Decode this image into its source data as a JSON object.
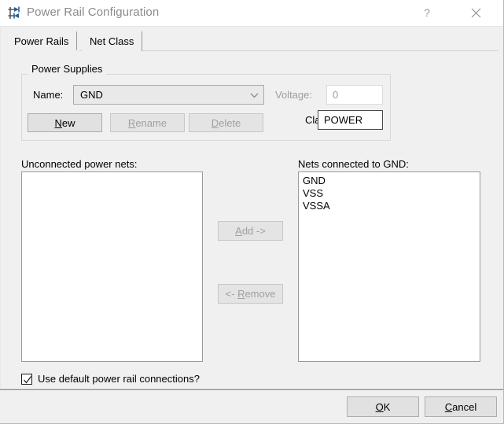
{
  "window": {
    "title": "Power Rail Configuration",
    "icon": "power-rail-icon",
    "help_label": "?",
    "close_label": "✕"
  },
  "tabs": [
    {
      "label": "Power Rails",
      "selected": true
    },
    {
      "label": "Net Class",
      "selected": false
    }
  ],
  "power_supplies": {
    "group_title": "Power Supplies",
    "name_label": "Name:",
    "name_value": "GND",
    "name_dropdown_icon": "chevron-down-icon",
    "voltage_label": "Voltage:",
    "voltage_value": "0",
    "voltage_enabled": false,
    "class_label": "Class:",
    "class_value": "POWER",
    "class_enabled": true,
    "buttons": {
      "new": "New",
      "rename": "Rename",
      "delete": "Delete"
    }
  },
  "unconnected": {
    "label": "Unconnected power nets:",
    "items": []
  },
  "connected": {
    "label": "Nets connected to GND:",
    "items": [
      "GND",
      "VSS",
      "VSSA"
    ]
  },
  "transfer": {
    "add_label": "Add ->",
    "remove_label": "<- Remove"
  },
  "options": {
    "use_default_label": "Use default power rail connections?",
    "use_default_checked": true
  },
  "footer": {
    "ok_label": "OK",
    "cancel_label": "Cancel"
  },
  "colors": {
    "dialog_bg": "#f0f0f0",
    "titlebar_bg": "#ffffff",
    "title_fg": "#8b8b8b",
    "button_face": "#e1e1e1",
    "field_bg": "#ffffff",
    "accent_icon": "#2a6099"
  }
}
